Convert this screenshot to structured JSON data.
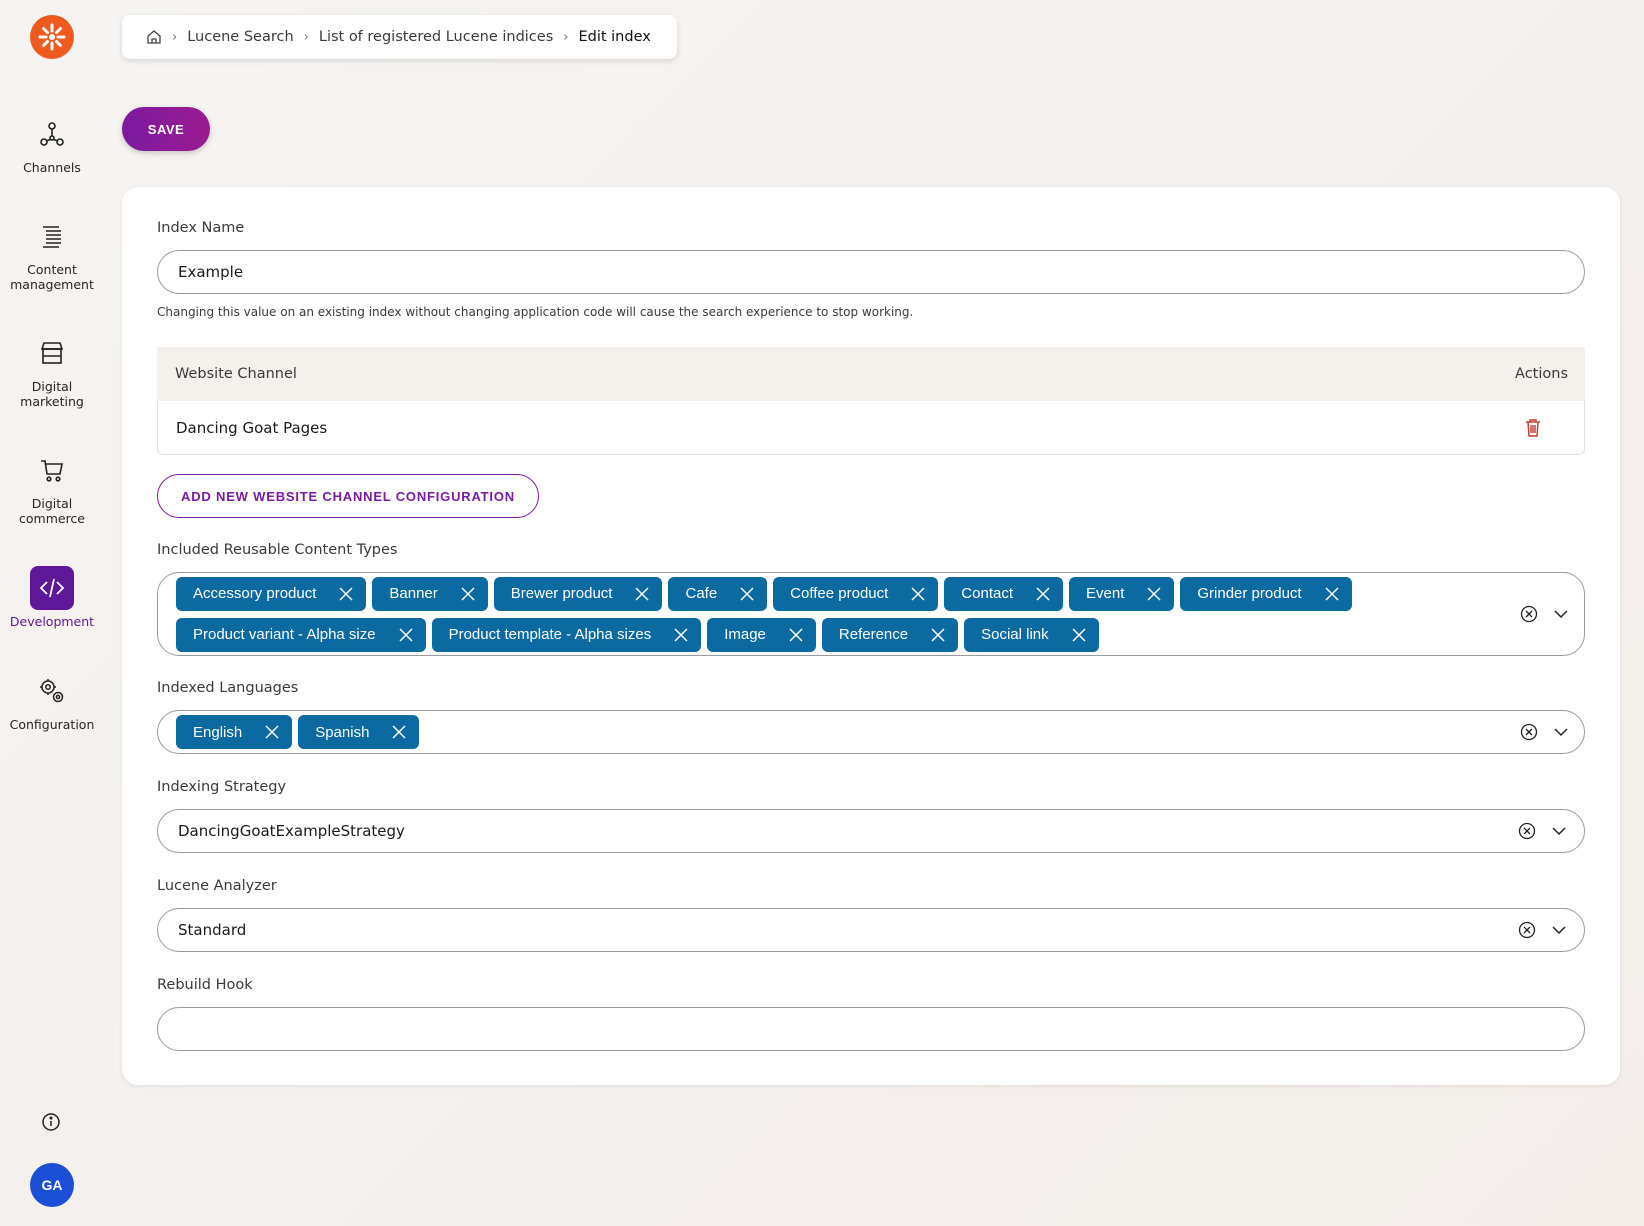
{
  "sidebar": {
    "items": [
      {
        "label": "Channels"
      },
      {
        "label": "Content management"
      },
      {
        "label": "Digital marketing"
      },
      {
        "label": "Digital commerce"
      },
      {
        "label": "Development"
      },
      {
        "label": "Configuration"
      }
    ],
    "avatar_initials": "GA"
  },
  "breadcrumb": {
    "items": [
      "Lucene Search",
      "List of registered Lucene indices",
      "Edit index"
    ]
  },
  "toolbar": {
    "save_label": "SAVE"
  },
  "form": {
    "index_name": {
      "label": "Index Name",
      "value": "Example",
      "hint": "Changing this value on an existing index without changing application code will cause the search experience to stop working."
    },
    "channels_table": {
      "columns": [
        "Website Channel",
        "Actions"
      ],
      "rows": [
        {
          "channel": "Dancing Goat Pages"
        }
      ]
    },
    "add_channel_label": "ADD NEW WEBSITE CHANNEL CONFIGURATION",
    "content_types": {
      "label": "Included Reusable Content Types",
      "tags": [
        "Accessory product",
        "Banner",
        "Brewer product",
        "Cafe",
        "Coffee product",
        "Contact",
        "Event",
        "Grinder product",
        "Product variant - Alpha size",
        "Product template - Alpha sizes",
        "Image",
        "Reference",
        "Social link"
      ]
    },
    "languages": {
      "label": "Indexed Languages",
      "tags": [
        "English",
        "Spanish"
      ]
    },
    "strategy": {
      "label": "Indexing Strategy",
      "value": "DancingGoatExampleStrategy"
    },
    "analyzer": {
      "label": "Lucene Analyzer",
      "value": "Standard"
    },
    "rebuild_hook": {
      "label": "Rebuild Hook",
      "value": ""
    }
  },
  "colors": {
    "accent": "#7b1aa0",
    "tag": "#0b6aa2",
    "logo": "#ef5a1f",
    "active_nav": "#5e1796",
    "avatar": "#1a4fd6",
    "delete": "#c0392b"
  }
}
